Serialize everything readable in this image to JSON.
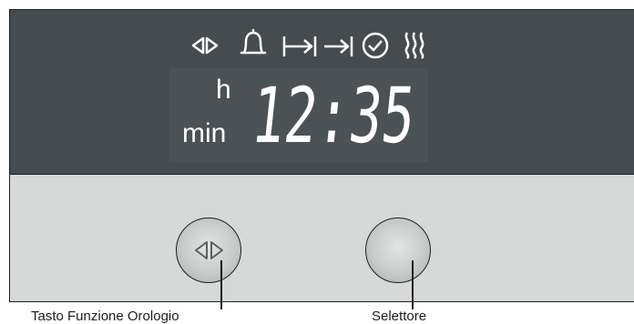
{
  "display": {
    "indicator_icons": [
      "clock-function-icon",
      "timer-bell-icon",
      "cooking-time-icon",
      "end-time-icon",
      "clock-icon",
      "heating-icon"
    ],
    "unit_hours": "h",
    "unit_minutes": "min",
    "time": "12:35"
  },
  "buttons": {
    "clock_function_label": "Tasto Funzione Orologio",
    "selector_label": "Selettore"
  },
  "colors": {
    "display_background": "#444c4f",
    "panel_background": "#d7d9d8",
    "segment_color": "#ffffff"
  }
}
